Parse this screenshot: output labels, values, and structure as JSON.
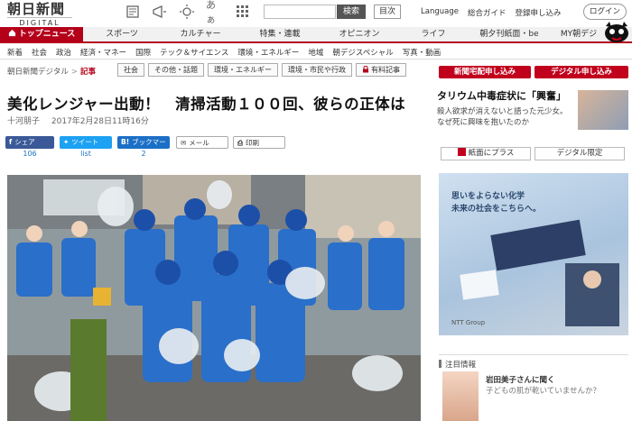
{
  "header": {
    "logo_main": "朝日新聞",
    "logo_sub": "DIGITAL",
    "icon_text": "あぁ",
    "search_button": "検索",
    "toc_button": "目次",
    "links": [
      "Language",
      "総合ガイド",
      "登録申し込み"
    ],
    "login": "ログイン"
  },
  "nav": {
    "items": [
      "トップニュース",
      "スポーツ",
      "カルチャー",
      "特集・連載",
      "オピニオン",
      "ライフ",
      "朝夕刊紙面・be",
      "MY朝デジ"
    ]
  },
  "subnav": [
    "新着",
    "社会",
    "政治",
    "経済・マネー",
    "国際",
    "テック＆サイエンス",
    "環境・エネルギー",
    "地域",
    "朝デジスペシャル",
    "写真・動画"
  ],
  "breadcrumb": {
    "site": "朝日新聞デジタル",
    "sep": ">",
    "current": "記事"
  },
  "tags": [
    "社会",
    "その他・話題",
    "環境・エネルギー",
    "環境・市民や行政",
    "有料記事"
  ],
  "article": {
    "headline": "美化レンジャー出動！　清掃活動１００回、彼らの正体は",
    "author": "十河朋子",
    "date": "2017年2月28日11時16分"
  },
  "share": {
    "facebook": "シェア",
    "facebook_count": "106",
    "twitter": "ツイート",
    "twitter_count": "list",
    "hatena": "ブックマーク",
    "hatena_count": "2",
    "mail": "メール",
    "print": "印刷"
  },
  "right": {
    "btn_paper": "新聞宅配申し込み",
    "btn_digital": "デジタル申し込み",
    "news_title": "タリウム中毒症状に「興奮」",
    "news_desc": "殺人欲求が消えないと語った元少女。なぜ死に興味を抱いたのか",
    "btn_clip": "紙面にプラス",
    "btn_limited": "デジタル限定",
    "ad_line1": "思いをよらない化学",
    "ad_line2": "未来の社会をこちらへ。",
    "ad_foot": "NTT Group",
    "section_label": "注目情報",
    "related_title": "岩田美子さんに聞く",
    "related_desc": "子どもの肌が乾いていませんか？"
  },
  "colors": {
    "brand_red": "#b5001a",
    "facebook": "#3b5998",
    "twitter": "#1da1f2",
    "hatena": "#1b6fc6"
  }
}
